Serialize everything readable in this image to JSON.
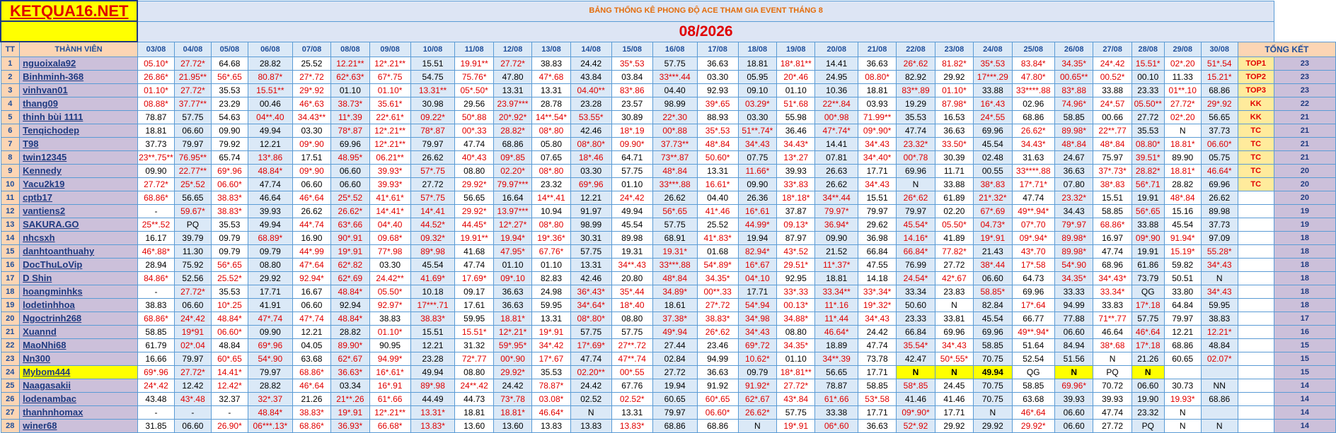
{
  "header": {
    "logo": "KETQUA16.NET",
    "title": "BẢNG THỐNG KÊ PHONG ĐỘ ACE THAM GIA EVENT THÁNG 8",
    "month": "08/2026",
    "col_tt": "TT",
    "col_member": "THÀNH VIÊN",
    "col_total": "TỔNG KẾT"
  },
  "dates": [
    "03/08",
    "04/08",
    "05/08",
    "06/08",
    "07/08",
    "08/08",
    "09/08",
    "10/08",
    "11/08",
    "12/08",
    "13/08",
    "14/08",
    "15/08",
    "16/08",
    "17/08",
    "18/08",
    "19/08",
    "20/08",
    "21/08",
    "22/08",
    "23/08",
    "24/08",
    "25/08",
    "26/08",
    "27/08",
    "28/08",
    "29/08",
    "30/08"
  ],
  "rows": [
    {
      "tt": "1",
      "name": "nguoixala92",
      "rank": "TOP1",
      "total": "23",
      "cells": [
        "05.10*",
        "27.72*",
        "64.68",
        "28.82",
        "25.52",
        "12.21**",
        "12*.21**",
        "15.51",
        "19.91**",
        "27.72*",
        "38.83",
        "24.42",
        "35*.53",
        "57.75",
        "36.63",
        "18.81",
        "18*.81**",
        "14.41",
        "36.63",
        "26*.62",
        "81.82*",
        "35*.53",
        "83.84*",
        "34.35*",
        "24*.42",
        "15.51*",
        "02*.20",
        "51*.54"
      ]
    },
    {
      "tt": "2",
      "name": "Binhminh-368",
      "rank": "TOP2",
      "total": "23",
      "cells": [
        "26.86*",
        "21.95**",
        "56*.65",
        "80.87*",
        "27*.72",
        "62*.63*",
        "67*.75",
        "54.75",
        "75.76*",
        "47.80",
        "47*.68",
        "43.84",
        "03.84",
        "33***.44",
        "03.30",
        "05.95",
        "20*.46",
        "24.95",
        "08.80*",
        "82.92",
        "29.92",
        "17***.29",
        "47.80*",
        "00.65**",
        "00.52*",
        "00.10",
        "11.33",
        "15.21*"
      ]
    },
    {
      "tt": "3",
      "name": "vinhvan01",
      "rank": "TOP3",
      "total": "23",
      "cells": [
        "01.10*",
        "27.72*",
        "35.53",
        "15.51**",
        "29*.92",
        "01.10",
        "01.10*",
        "13.31**",
        "05*.50*",
        "13.31",
        "13.31",
        "04.40**",
        "83*.86",
        "04.40",
        "92.93",
        "09.10",
        "01.10",
        "10.36",
        "18.81",
        "83**.89",
        "01.10*",
        "33.88",
        "33****.88",
        "83*.88",
        "33.88",
        "23.33",
        "01**.10",
        "68.86"
      ]
    },
    {
      "tt": "4",
      "name": "thang09",
      "rank": "KK",
      "total": "22",
      "cells": [
        "08.88*",
        "37.77**",
        "23.29",
        "00.46",
        "46*.63",
        "38.73*",
        "35.61*",
        "30.98",
        "29.56",
        "23.97***",
        "28.78",
        "23.28",
        "23.57",
        "98.99",
        "39*.65",
        "03.29*",
        "51*.68",
        "22**.84",
        "03.93",
        "19.29",
        "87.98*",
        "16*.43",
        "02.96",
        "74.96*",
        "24*.57",
        "05.50**",
        "27.72*",
        "29*.92"
      ]
    },
    {
      "tt": "5",
      "name": "thinh bùi 1111",
      "rank": "KK",
      "total": "21",
      "cells": [
        "78.87",
        "57.75",
        "54.63",
        "04**.40",
        "34.43**",
        "11*.39",
        "22*.61*",
        "09.22*",
        "50*.88",
        "20*.92*",
        "14**.54*",
        "53.55*",
        "30.89",
        "22*.30",
        "88.93",
        "03.30",
        "55.98",
        "00*.98",
        "71.99**",
        "35.53",
        "16.53",
        "24*.55",
        "68.86",
        "58.85",
        "00.66",
        "27.72",
        "02*.20",
        "56.65"
      ]
    },
    {
      "tt": "6",
      "name": "Tenqichodep",
      "rank": "TC",
      "total": "21",
      "cells": [
        "18.81",
        "06.60",
        "09.90",
        "49.94",
        "03.30",
        "78*.87",
        "12*.21**",
        "78*.87",
        "00*.33",
        "28.82*",
        "08*.80",
        "42.46",
        "18*.19",
        "00*.88",
        "35*.53",
        "51**.74*",
        "36.46",
        "47*.74*",
        "09*.90*",
        "47.74",
        "36.63",
        "69.96",
        "26.62*",
        "89.98*",
        "22**.77",
        "35.53",
        "N",
        "37.73"
      ]
    },
    {
      "tt": "7",
      "name": "T98",
      "rank": "TC",
      "total": "21",
      "cells": [
        "37.73",
        "79.97",
        "79.92",
        "12.21",
        "09*.90",
        "69.96",
        "12*.21**",
        "79.97",
        "47.74",
        "68.86",
        "05.80",
        "08*.80*",
        "09.90*",
        "37.73**",
        "48*.84",
        "34*.43",
        "34.43*",
        "14.41",
        "34*.43",
        "23.32*",
        "33.50*",
        "45.54",
        "34.43*",
        "48*.84",
        "48*.84",
        "08.80*",
        "18.81*",
        "06.60*"
      ]
    },
    {
      "tt": "8",
      "name": "twin12345",
      "rank": "TC",
      "total": "21",
      "cells": [
        "23**.75**",
        "76.95**",
        "65.74",
        "13*.86",
        "17.51",
        "48.95*",
        "06.21**",
        "26.62",
        "40*.43",
        "09*.85",
        "07.65",
        "18*.46",
        "64.71",
        "73**.87",
        "50.60*",
        "07.75",
        "13*.27",
        "07.81",
        "34*.40*",
        "00*.78",
        "30.39",
        "02.48",
        "31.63",
        "24.67",
        "75.97",
        "39.51*",
        "89.90",
        "05.75"
      ]
    },
    {
      "tt": "9",
      "name": "Kennedy",
      "rank": "TC",
      "total": "20",
      "cells": [
        "09.90",
        "22.77**",
        "69*.96",
        "48.84*",
        "09*.90",
        "06.60",
        "39.93*",
        "57*.75",
        "08.80",
        "02.20*",
        "08*.80",
        "03.30",
        "57.75",
        "48*.84",
        "13.31",
        "11.66*",
        "39.93",
        "26.63",
        "17.71",
        "69.96",
        "11.71",
        "00.55",
        "33****.88",
        "36.63",
        "37*.73*",
        "28.82*",
        "18.81*",
        "46.64*"
      ]
    },
    {
      "tt": "10",
      "name": "Yacu2k19",
      "rank": "TC",
      "total": "20",
      "cells": [
        "27.72*",
        "25*.52",
        "06.60*",
        "47.74",
        "06.60",
        "06.60",
        "39.93*",
        "27.72",
        "29.92*",
        "79.97***",
        "23.32",
        "69*.96",
        "01.10",
        "33***.88",
        "16.61*",
        "09.90",
        "33*.83",
        "26.62",
        "34*.43",
        "N",
        "33.88",
        "38*.83",
        "17*.71*",
        "07.80",
        "38*.83",
        "56*.71",
        "28.82",
        "69.96"
      ]
    },
    {
      "tt": "11",
      "name": "cptb17",
      "rank": "",
      "total": "20",
      "cells": [
        "68.86*",
        "56.65",
        "38.83*",
        "46.64",
        "46*.64",
        "25*.52",
        "41*.61*",
        "57*.75",
        "56.65",
        "16.64",
        "14**.41",
        "12.21",
        "24*.42",
        "26.62",
        "04.40",
        "26.36",
        "18*.18*",
        "34**.44",
        "15.51",
        "26*.62",
        "61.89",
        "21*.32*",
        "47.74",
        "23.32*",
        "15.51",
        "19.91",
        "48*.84",
        "26.62"
      ]
    },
    {
      "tt": "12",
      "name": "vantiens2",
      "rank": "",
      "total": "19",
      "cells": [
        "-",
        "59.67*",
        "38.83*",
        "39.93",
        "26.62",
        "26.62*",
        "14*.41*",
        "14*.41",
        "29.92*",
        "13.97***",
        "10.94",
        "91.97",
        "49.94",
        "56*.65",
        "41*.46",
        "16*.61",
        "37.87",
        "79.97*",
        "79.97",
        "79.97",
        "02.20",
        "67*.69",
        "49**.94*",
        "34.43",
        "58.85",
        "56*.65",
        "15.16",
        "89.98"
      ]
    },
    {
      "tt": "13",
      "name": "SAKURA.GO",
      "rank": "",
      "total": "19",
      "cells": [
        "25**.52",
        "PQ",
        "35.53",
        "49.94",
        "44*.74",
        "63*.66",
        "04*.40",
        "44.52*",
        "44.45*",
        "12*.27*",
        "08*.80",
        "98.99",
        "45.54",
        "57.75",
        "25.52",
        "44.99*",
        "09.13*",
        "36.94*",
        "29.62",
        "45.54*",
        "05.50*",
        "04.73*",
        "07*.70",
        "79*.97",
        "68.86*",
        "33.88",
        "45.54",
        "37.73"
      ]
    },
    {
      "tt": "14",
      "name": "nhcsxh",
      "rank": "",
      "total": "18",
      "cells": [
        "16.17",
        "39.79",
        "09.79",
        "68.89*",
        "16.90",
        "90*.91",
        "09.68*",
        "09.32*",
        "19.91**",
        "19.94*",
        "19*.36*",
        "30.31",
        "89.98",
        "68.91",
        "41*.83*",
        "19.94",
        "87.97",
        "09.90",
        "36.98",
        "14.16*",
        "41.89",
        "19*.91",
        "09*.94*",
        "89.98*",
        "16.97",
        "09*.90",
        "91.94*",
        "97.09"
      ]
    },
    {
      "tt": "15",
      "name": "danhtoanthuahy",
      "rank": "",
      "total": "18",
      "cells": [
        "46*.88*",
        "11.30",
        "09.79",
        "09.79",
        "44*.99",
        "19*.91",
        "77*.98",
        "89*.98",
        "41.68",
        "47.95*",
        "67.76*",
        "57.75",
        "19.31",
        "19.31*",
        "01.68",
        "82.94*",
        "43*.52",
        "21.52",
        "66.84",
        "66.84*",
        "77.82*",
        "21.43",
        "43*.70",
        "89.98*",
        "47.74",
        "19.91",
        "15.19*",
        "55.28*"
      ]
    },
    {
      "tt": "16",
      "name": "DocThuLoVip",
      "rank": "",
      "total": "18",
      "cells": [
        "28.94",
        "75.92",
        "56*.65",
        "08.80",
        "47*.64",
        "62*.82",
        "03.30",
        "45.54",
        "47.74",
        "01.10",
        "01.10",
        "13.31",
        "34**.43",
        "33***.88",
        "54*.89*",
        "16*.67",
        "29.51*",
        "11*.37*",
        "47.55",
        "76.99",
        "27.72",
        "38*.44",
        "17*.58",
        "54*.90",
        "68.96",
        "61.86",
        "59.82",
        "34*.43"
      ]
    },
    {
      "tt": "17",
      "name": "D Shin",
      "rank": "",
      "total": "18",
      "cells": [
        "84.86*",
        "52.56",
        "25.52*",
        "29.92",
        "92.94*",
        "62*.69",
        "24.42**",
        "41.69*",
        "17.69*",
        "09*.10",
        "82.83",
        "42.46",
        "20.80",
        "48*.84",
        "34.35*",
        "04*.10",
        "92.95",
        "18.81",
        "14.18",
        "24.54*",
        "42*.67",
        "06.60",
        "64.73",
        "34.35*",
        "34*.43*",
        "73.79",
        "50.51",
        "N"
      ]
    },
    {
      "tt": "18",
      "name": "hoangminhks",
      "rank": "",
      "total": "18",
      "cells": [
        "-",
        "27.72*",
        "35.53",
        "17.71",
        "16.67",
        "48.84*",
        "05.50*",
        "10.18",
        "09.17",
        "36.63",
        "24.98",
        "36*.43*",
        "35*.44",
        "34.89*",
        "00**.33",
        "17.71",
        "33*.33",
        "33.34**",
        "33*.34*",
        "33.34",
        "23.83",
        "58.85*",
        "69.96",
        "33.33",
        "33.34*",
        "QG",
        "33.80",
        "34*.43"
      ]
    },
    {
      "tt": "19",
      "name": "lodetinhhoa",
      "rank": "",
      "total": "18",
      "cells": [
        "38.83",
        "06.60",
        "10*.25",
        "41.91",
        "06.60",
        "92.94",
        "92.97*",
        "17***.71",
        "17.61",
        "36.63",
        "59.95",
        "34*.64*",
        "18*.40",
        "18.61",
        "27*.72",
        "54*.94",
        "00.13*",
        "11*.16",
        "19*.32*",
        "50.60",
        "N",
        "82.84",
        "17*.64",
        "94.99",
        "33.83",
        "17*.18",
        "64.84",
        "59.95"
      ]
    },
    {
      "tt": "20",
      "name": "Ngoctrinh268",
      "rank": "",
      "total": "17",
      "cells": [
        "68.86*",
        "24*.42",
        "48.84*",
        "47*.74",
        "47*.74",
        "48.84*",
        "38.83",
        "38.83*",
        "59.95",
        "18.81*",
        "13.31",
        "08*.80*",
        "08.80",
        "37.38*",
        "38.83*",
        "34*.98",
        "34.88*",
        "11*.44",
        "34*.43",
        "23.33",
        "33.81",
        "45.54",
        "66.77",
        "77.88",
        "71**.77",
        "57.75",
        "79.97",
        "38.83"
      ]
    },
    {
      "tt": "21",
      "name": "Xuannd",
      "rank": "",
      "total": "16",
      "cells": [
        "58.85",
        "19*91",
        "06.60*",
        "09.90",
        "12.21",
        "28.82",
        "01.10*",
        "15.51",
        "15.51*",
        "12*.21*",
        "19*.91",
        "57.75",
        "57.75",
        "49*.94",
        "26*.62",
        "34*.43",
        "08.80",
        "46.64*",
        "24.42",
        "66.84",
        "69.96",
        "69.96",
        "49**.94*",
        "06.60",
        "46.64",
        "46*.64",
        "12.21",
        "12.21*"
      ]
    },
    {
      "tt": "22",
      "name": "MaoNhi68",
      "rank": "",
      "total": "15",
      "cells": [
        "61.79",
        "02*.04",
        "48.84",
        "69*.96",
        "04.05",
        "89.90*",
        "90.95",
        "12.21",
        "31.32",
        "59*.95*",
        "34*.42",
        "17*.69*",
        "27**.72",
        "27.44",
        "23.46",
        "69*.72",
        "34.35*",
        "18.89",
        "47.74",
        "35.54*",
        "34*.43",
        "58.85",
        "51.64",
        "84.94",
        "38*.68",
        "17*.18",
        "68.86",
        "48.84"
      ]
    },
    {
      "tt": "23",
      "name": "Nn300",
      "rank": "",
      "total": "15",
      "cells": [
        "16.66",
        "79.97",
        "60*.65",
        "54*.90",
        "63.68",
        "62*.67",
        "94.99*",
        "23.28",
        "72*.77",
        "00*.90",
        "17*.67",
        "47.74",
        "47**.74",
        "02.84",
        "94.99",
        "10.62*",
        "01.10",
        "34**.39",
        "73.78",
        "42.47",
        "50*.55*",
        "70.75",
        "52.54",
        "51.56",
        "N",
        "21.26",
        "60.65",
        "02.07*"
      ]
    },
    {
      "tt": "24",
      "name": "Mybom444",
      "rank": "",
      "total": "15",
      "hl": true,
      "cells": [
        "69*.96",
        "27.72*",
        "14.41*",
        "79.97",
        "68.86*",
        "36.63*",
        "16*.61*",
        "49.94",
        "08.80",
        "29.92*",
        "35.53",
        "02.20**",
        "00*.55",
        "27.72",
        "36.63",
        "09.79",
        "18*.81**",
        "56.65",
        "17.71",
        "N",
        "N",
        "49.94",
        "QG",
        "N",
        "PQ",
        "N",
        "",
        ""
      ]
    },
    {
      "tt": "25",
      "name": "Naagasakii",
      "rank": "",
      "total": "14",
      "cells": [
        "24*.42",
        "12.42",
        "12.42*",
        "28.82",
        "46*.64",
        "03.34",
        "16*.91",
        "89*.98",
        "24**.42",
        "24.42",
        "78.87*",
        "24.42",
        "67.76",
        "19.94",
        "91.92",
        "91.92*",
        "27.72*",
        "78.87",
        "58.85",
        "58*.85",
        "24.45",
        "70.75",
        "58.85",
        "69.96*",
        "70.72",
        "06.60",
        "30.73",
        "NN"
      ]
    },
    {
      "tt": "26",
      "name": "lodenambac",
      "rank": "",
      "total": "14",
      "cells": [
        "43.48",
        "43*.48",
        "32.37",
        "32*.37",
        "21.26",
        "21**.26",
        "61*.66",
        "44.49",
        "44.73",
        "73*.78",
        "03.08*",
        "02.52",
        "02.52*",
        "60.65",
        "60*.65",
        "62*.67",
        "43*.84",
        "61*.66",
        "53*.58",
        "41.46",
        "41.46",
        "70.75",
        "63.68",
        "39.93",
        "39.93",
        "19.90",
        "19.93*",
        "68.86"
      ]
    },
    {
      "tt": "27",
      "name": "thanhnhomax",
      "rank": "",
      "total": "14",
      "cells": [
        "-",
        "-",
        "-",
        "48.84*",
        "38.83*",
        "19*.91",
        "12*.21**",
        "13.31*",
        "18.81",
        "18.81*",
        "46.64*",
        "N",
        "13.31",
        "79.97",
        "06.60*",
        "26.62*",
        "57.75",
        "33.38",
        "17.71",
        "09*.90*",
        "17.71",
        "N",
        "46*.64",
        "06.60",
        "47.74",
        "23.32",
        "N",
        ""
      ]
    },
    {
      "tt": "28",
      "name": "winer68",
      "rank": "",
      "total": "14",
      "cells": [
        "31.85",
        "06.60",
        "26.90*",
        "06***.13*",
        "68.86*",
        "36.93*",
        "66.68*",
        "13.83*",
        "13.60",
        "13.60",
        "13.83",
        "13.83",
        "13.83*",
        "68.86",
        "68.86",
        "N",
        "19*.91",
        "06*.60",
        "36.63",
        "52*.92",
        "29.92",
        "29.92",
        "29.92*",
        "06.60",
        "27.72",
        "PQ",
        "N",
        "N"
      ]
    }
  ]
}
